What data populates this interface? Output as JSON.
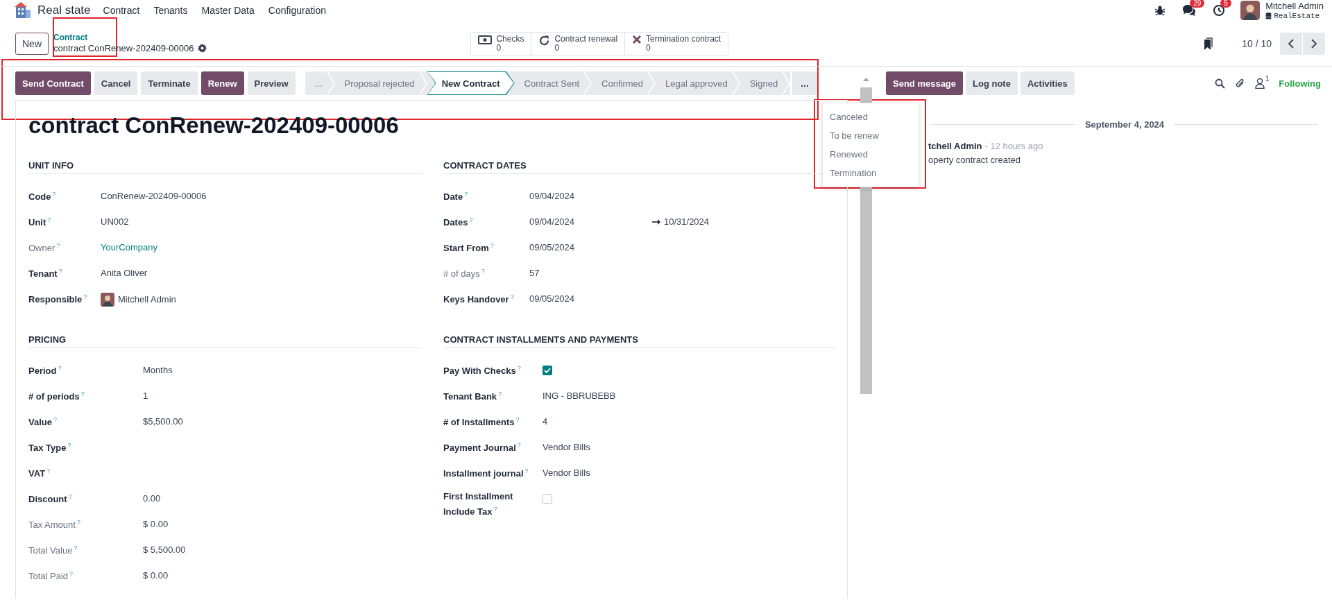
{
  "navbar": {
    "app_name": "Real state",
    "menus": [
      "Contract",
      "Tenants",
      "Master Data",
      "Configuration"
    ],
    "messages_count": "29",
    "activities_count": "5",
    "user": {
      "name": "Mitchell Admin",
      "database": "RealEstate"
    }
  },
  "control_panel": {
    "new_button": "New",
    "breadcrumb": {
      "parent": "Contract",
      "current": "contract ConRenew-202409-00006"
    },
    "smart_buttons": [
      {
        "kind": "checks",
        "label": "Checks",
        "count": "0"
      },
      {
        "kind": "renewal",
        "label": "Contract renewal",
        "count": "0"
      },
      {
        "kind": "termination",
        "label": "Termination contract",
        "count": "0"
      }
    ],
    "pager": "10 / 10"
  },
  "action_buttons": [
    {
      "label": "Send Contract",
      "primary": true
    },
    {
      "label": "Cancel",
      "primary": false
    },
    {
      "label": "Terminate",
      "primary": false
    },
    {
      "label": "Renew",
      "primary": true
    },
    {
      "label": "Preview",
      "primary": false
    }
  ],
  "status_bar": {
    "stages": [
      {
        "label": "...",
        "selected": false
      },
      {
        "label": "Proposal rejected",
        "selected": false
      },
      {
        "label": "New Contract",
        "selected": true
      },
      {
        "label": "Contract Sent",
        "selected": false
      },
      {
        "label": "Confirmed",
        "selected": false
      },
      {
        "label": "Legal approved",
        "selected": false
      },
      {
        "label": "Signed",
        "selected": false
      }
    ],
    "more_button": "..."
  },
  "status_menu": {
    "items": [
      "Canceled",
      "To be renew",
      "Renewed",
      "Termination"
    ]
  },
  "form": {
    "title": "contract ConRenew-202409-00006",
    "sections": [
      {
        "title": "UNIT INFO",
        "fields": [
          {
            "label": "Code$^{?}$",
            "kind": "text",
            "readonly": false,
            "value": "ConRenew-202409-00006"
          },
          {
            "label": "Unit$^{?}$",
            "kind": "text",
            "readonly": false,
            "value": "UN002"
          },
          {
            "label": "Owner$^{?}$",
            "kind": "link",
            "readonly": true,
            "value": "YourCompany"
          },
          {
            "label": "Tenant$^{?}$",
            "kind": "text",
            "readonly": false,
            "value": "Anita Oliver"
          },
          {
            "label": "Responsible$^{?}$",
            "kind": "user",
            "readonly": false,
            "value": "Mitchell Admin"
          }
        ]
      },
      {
        "title": "CONTRACT DATES",
        "fields": [
          {
            "label": "Date$^{?}$",
            "kind": "text",
            "readonly": false,
            "value": "09/04/2024"
          },
          {
            "label": "Dates$^{?}$",
            "kind": "daterange",
            "readonly": false,
            "value": "09/04/2024",
            "value_end": "10/31/2024"
          },
          {
            "label": "Start From$^{?}$",
            "kind": "text",
            "readonly": false,
            "value": "09/05/2024"
          },
          {
            "label": "# of days$^{?}$",
            "kind": "text",
            "readonly": true,
            "value": "57"
          },
          {
            "label": "Keys Handover$^{?}$",
            "kind": "text",
            "readonly": false,
            "value": "09/05/2024"
          }
        ]
      },
      {
        "title": "PRICING",
        "fields": [
          {
            "label": "Period$^{?}$",
            "kind": "text",
            "readonly": false,
            "value": "Months"
          },
          {
            "label": "# of periods$^{?}$",
            "kind": "text",
            "readonly": false,
            "value": "1"
          },
          {
            "label": "Value$^{?}$",
            "kind": "text",
            "readonly": false,
            "value": "$5,500.00"
          },
          {
            "label": "Tax Type$^{?}$",
            "kind": "text",
            "readonly": false
          },
          {
            "label": "VAT$^{?}$",
            "kind": "text",
            "readonly": false
          },
          {
            "label": "Discount$^{?}$",
            "kind": "text",
            "readonly": false,
            "value": "0.00"
          },
          {
            "label": "Tax Amount$^{?}$",
            "kind": "text",
            "readonly": true,
            "value": "$ 0.00"
          },
          {
            "label": "Total Value$^{?}$",
            "kind": "text",
            "readonly": true,
            "value": "$ 5,500.00"
          },
          {
            "label": "Total Paid$^{?}$",
            "kind": "text",
            "readonly": true,
            "value": "$ 0.00"
          }
        ]
      },
      {
        "title": "CONTRACT INSTALLMENTS AND PAYMENTS",
        "fields": [
          {
            "label": "Pay With Checks$^{?}$",
            "kind": "checkbox",
            "readonly": false,
            "checked": true
          },
          {
            "label": "Tenant Bank$^{?}$",
            "kind": "text",
            "readonly": false,
            "value": "ING - BBRUBEBB"
          },
          {
            "label": "# of Installments$^{?}$",
            "kind": "text",
            "readonly": false,
            "value": "4"
          },
          {
            "label": "Payment Journal$^{?}$",
            "kind": "text",
            "readonly": false,
            "value": "Vendor Bills"
          },
          {
            "label": "Installment journal$^{?}$",
            "kind": "text",
            "readonly": false,
            "value": "Vendor Bills"
          },
          {
            "label": "First Installment Include Tax$^{?}$",
            "kind": "checkbox",
            "readonly": false,
            "checked": false
          }
        ]
      }
    ]
  },
  "chatter": {
    "buttons": [
      {
        "label": "Send message",
        "primary": true
      },
      {
        "label": "Log note",
        "primary": false
      },
      {
        "label": "Activities",
        "primary": false
      }
    ],
    "followers_count": "1",
    "follow_status": "Following",
    "date": "September 4, 2024",
    "message": {
      "author": "tchell Admin",
      "time": "- 12 hours ago",
      "body": "operty contract created"
    }
  }
}
